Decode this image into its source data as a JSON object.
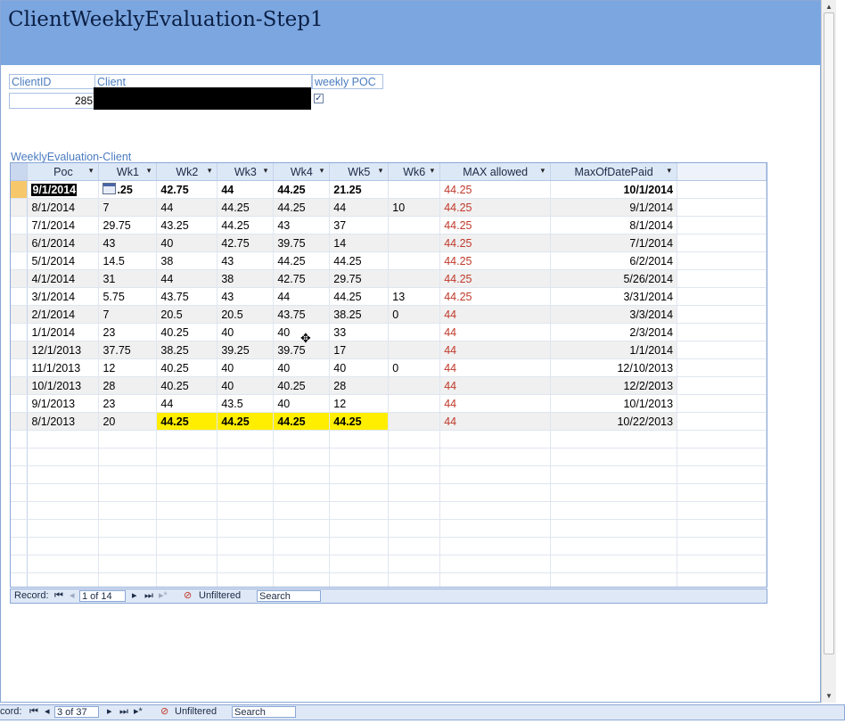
{
  "form": {
    "title": "ClientWeeklyEvaluation-Step1",
    "client_id_label": "ClientID",
    "client_label": "Client",
    "weekly_poc_label": "weekly POC",
    "client_id_value": "285",
    "weekly_poc_checked": "✓"
  },
  "subform": {
    "label": "WeeklyEvaluation-Client",
    "columns": [
      "Poc",
      "Wk1",
      "Wk2",
      "Wk3",
      "Wk4",
      "Wk5",
      "Wk6",
      "MAX allowed",
      "MaxOfDatePaid"
    ],
    "sort_arrow": "▾",
    "rows": [
      {
        "poc": "9/1/2014",
        "wk1": ".25",
        "wk2": "42.75",
        "wk3": "44",
        "wk4": "44.25",
        "wk5": "21.25",
        "wk6": "",
        "max": "44.25",
        "paid": "10/1/2014"
      },
      {
        "poc": "8/1/2014",
        "wk1": "7",
        "wk2": "44",
        "wk3": "44.25",
        "wk4": "44.25",
        "wk5": "44",
        "wk6": "10",
        "max": "44.25",
        "paid": "9/1/2014"
      },
      {
        "poc": "7/1/2014",
        "wk1": "29.75",
        "wk2": "43.25",
        "wk3": "44.25",
        "wk4": "43",
        "wk5": "37",
        "wk6": "",
        "max": "44.25",
        "paid": "8/1/2014"
      },
      {
        "poc": "6/1/2014",
        "wk1": "43",
        "wk2": "40",
        "wk3": "42.75",
        "wk4": "39.75",
        "wk5": "14",
        "wk6": "",
        "max": "44.25",
        "paid": "7/1/2014"
      },
      {
        "poc": "5/1/2014",
        "wk1": "14.5",
        "wk2": "38",
        "wk3": "43",
        "wk4": "44.25",
        "wk5": "44.25",
        "wk6": "",
        "max": "44.25",
        "paid": "6/2/2014"
      },
      {
        "poc": "4/1/2014",
        "wk1": "31",
        "wk2": "44",
        "wk3": "38",
        "wk4": "42.75",
        "wk5": "29.75",
        "wk6": "",
        "max": "44.25",
        "paid": "5/26/2014"
      },
      {
        "poc": "3/1/2014",
        "wk1": "5.75",
        "wk2": "43.75",
        "wk3": "43",
        "wk4": "44",
        "wk5": "44.25",
        "wk6": "13",
        "max": "44.25",
        "paid": "3/31/2014"
      },
      {
        "poc": "2/1/2014",
        "wk1": "7",
        "wk2": "20.5",
        "wk3": "20.5",
        "wk4": "43.75",
        "wk5": "38.25",
        "wk6": "0",
        "max": "44",
        "paid": "3/3/2014"
      },
      {
        "poc": "1/1/2014",
        "wk1": "23",
        "wk2": "40.25",
        "wk3": "40",
        "wk4": "40",
        "wk5": "33",
        "wk6": "",
        "max": "44",
        "paid": "2/3/2014"
      },
      {
        "poc": "12/1/2013",
        "wk1": "37.75",
        "wk2": "38.25",
        "wk3": "39.25",
        "wk4": "39.75",
        "wk5": "17",
        "wk6": "",
        "max": "44",
        "paid": "1/1/2014"
      },
      {
        "poc": "11/1/2013",
        "wk1": "12",
        "wk2": "40.25",
        "wk3": "40",
        "wk4": "40",
        "wk5": "40",
        "wk6": "0",
        "max": "44",
        "paid": "12/10/2013"
      },
      {
        "poc": "10/1/2013",
        "wk1": "28",
        "wk2": "40.25",
        "wk3": "40",
        "wk4": "40.25",
        "wk5": "28",
        "wk6": "",
        "max": "44",
        "paid": "12/2/2013"
      },
      {
        "poc": "9/1/2013",
        "wk1": "23",
        "wk2": "44",
        "wk3": "43.5",
        "wk4": "40",
        "wk5": "12",
        "wk6": "",
        "max": "44",
        "paid": "10/1/2013"
      },
      {
        "poc": "8/1/2013",
        "wk1": "20",
        "wk2": "44.25",
        "wk3": "44.25",
        "wk4": "44.25",
        "wk5": "44.25",
        "wk6": "",
        "max": "44",
        "paid": "10/22/2013"
      }
    ],
    "highlight_color": "#ffee00",
    "max_allowed_color": "#c0392b"
  },
  "subform_nav": {
    "record_label": "Record:",
    "position": "1 of 14",
    "filter_label": "Unfiltered",
    "search_placeholder": "Search"
  },
  "form_nav": {
    "record_label": "cord:",
    "position": "3 of 37",
    "filter_label": "Unfiltered",
    "search_placeholder": "Search"
  }
}
